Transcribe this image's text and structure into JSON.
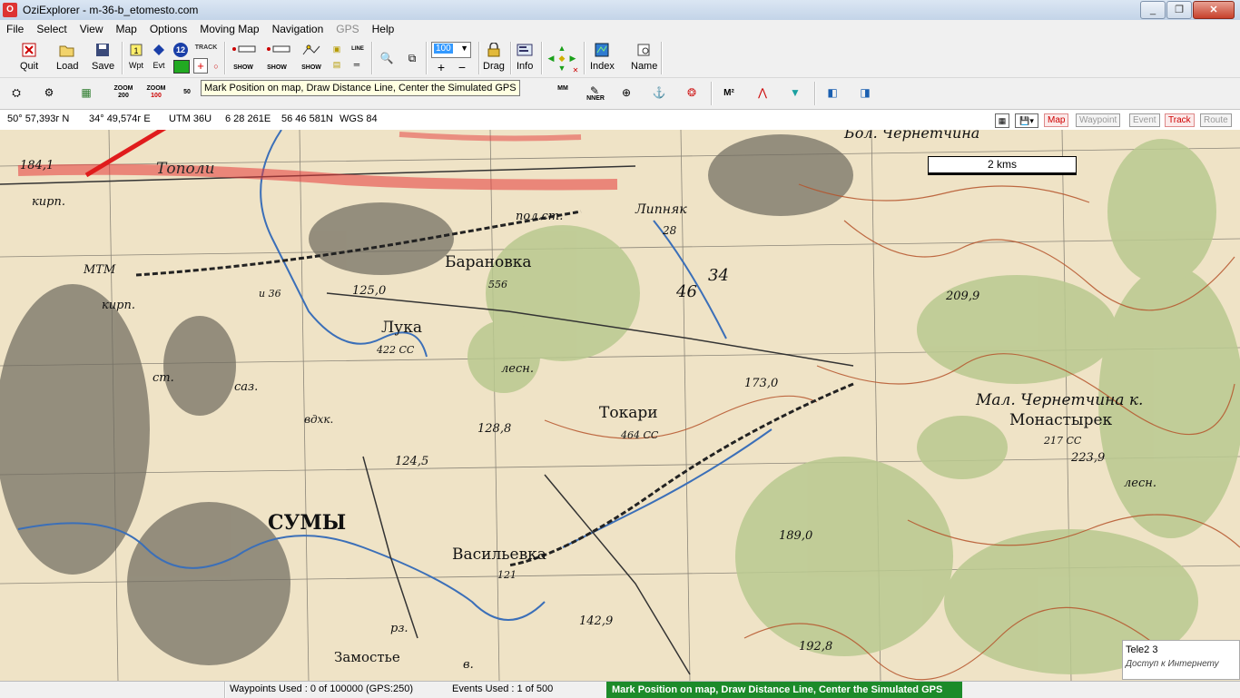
{
  "window": {
    "title": "OziExplorer - m-36-b_etomesto.com",
    "minimize": "_",
    "restore": "❐",
    "close": "✕"
  },
  "menu": [
    "File",
    "Select",
    "View",
    "Map",
    "Options",
    "Moving Map",
    "Navigation",
    "GPS",
    "Help"
  ],
  "toolbar": {
    "quit": "Quit",
    "load": "Load",
    "save": "Save",
    "wpt": "Wpt",
    "evt": "Evt",
    "gps_number": "12",
    "track": "TRACK",
    "show": "SHOW",
    "line": "LINE",
    "zoom_value": "100",
    "drag": "Drag",
    "info": "Info",
    "index": "Index",
    "name": "Name"
  },
  "toolbar2": {
    "zoom_label": "ZOOM",
    "zoom1": "200",
    "zoom2": "100",
    "zoom3": "50",
    "mm": "MM",
    "nner": "NNER",
    "m2": "M²"
  },
  "tooltip": "Mark Position on map, Draw Distance Line, Center the Simulated GPS",
  "coords": {
    "lat": "50° 57,393г N",
    "lon": "34° 49,574г E",
    "utm": "UTM  36U",
    "easting": "6 28 261E",
    "northing": "56 46 581N",
    "datum": "WGS 84"
  },
  "modes": [
    {
      "label": "Map",
      "active": true
    },
    {
      "label": "Waypoint",
      "active": false
    },
    {
      "label": "Event",
      "active": false
    },
    {
      "label": "Track",
      "active": true
    },
    {
      "label": "Route",
      "active": false
    }
  ],
  "map": {
    "scale": "2 kms",
    "labels": {
      "topoli": "Тополи",
      "alt1841": "184,1",
      "kirp1": "кирп.",
      "chernetchina_top": "Бол. Чернетчина",
      "lipnyak": "Липняк",
      "pol_st": "пол.ст.",
      "baranovka": "Барановка",
      "v556": "556",
      "v28": "28",
      "v46": "46",
      "v34": "34",
      "mtm": "МТМ",
      "kirp2": "кирп.",
      "alt1250": "125,0",
      "i36": "и 36",
      "luka": "Лука",
      "v422": "422 СС",
      "lesn1": "лесн.",
      "alt2099": "209,9",
      "st": "ст.",
      "saz": "саз.",
      "alt1730": "173,0",
      "mal_chernetchina": "Мал. Чернетчина к.",
      "monastyrek": "Монастырек",
      "tokari": "Токари",
      "v464": "464 СС",
      "alt1288": "128,8",
      "vdkh": "вдхк.",
      "alt1245": "124,5",
      "v217": "217 СС",
      "alt2239": "223,9",
      "lesn2": "лесн.",
      "sumy": "СУМЫ",
      "alt1890": "189,0",
      "vasilevka": "Васильевка",
      "v121": "121",
      "alt1429": "142,9",
      "rz": "рз.",
      "zamostye": "Замостье",
      "v": "в.",
      "alt1928": "192,8"
    }
  },
  "network_popup": {
    "carrier": "Tele2  3",
    "status": "Доступ к Интернету"
  },
  "status": {
    "waypoints": "Waypoints Used : 0 of 100000  (GPS:250)",
    "events": "Events Used : 1 of 500",
    "message": "Mark Position on map, Draw Distance Line, Center the Simulated GPS"
  },
  "colors": {
    "status_green": "#1c8b2a",
    "map_paper": "#efe3c6",
    "road_red": "#e53a3a",
    "arrow": "#e01c1c"
  }
}
